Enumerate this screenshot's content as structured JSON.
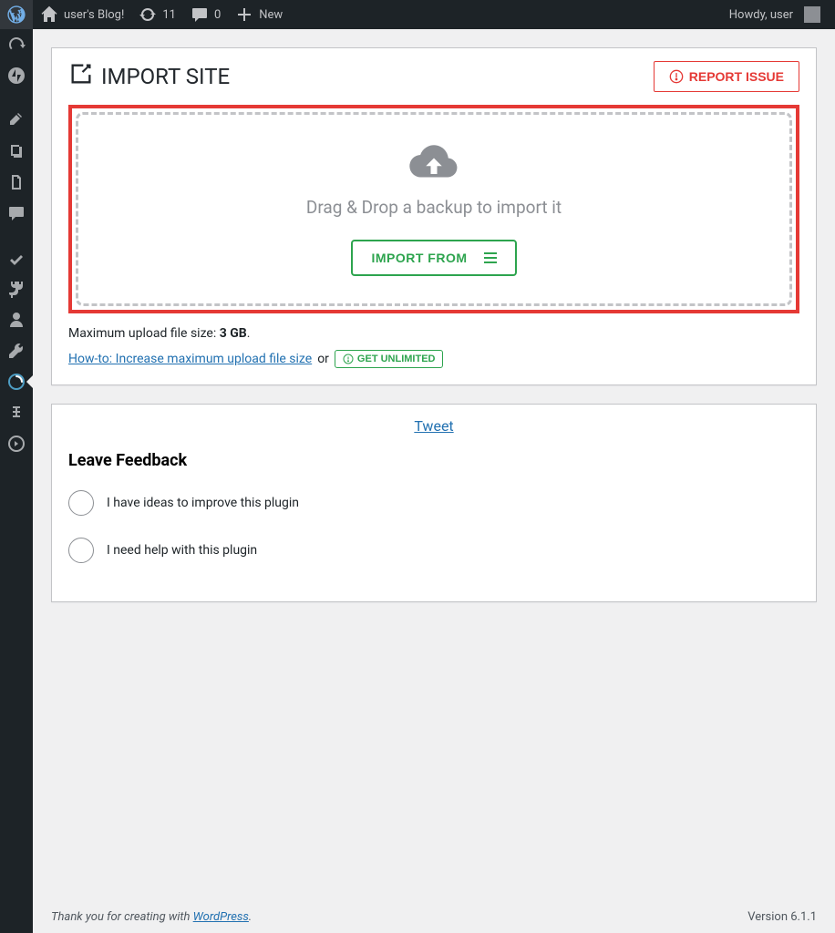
{
  "adminbar": {
    "site_name": "user's Blog!",
    "updates": "11",
    "comments": "0",
    "new_label": "New",
    "greeting": "Howdy, user"
  },
  "page": {
    "title": "IMPORT SITE",
    "report_issue": "REPORT ISSUE",
    "drop_text": "Drag & Drop a backup to import it",
    "import_from": "IMPORT FROM",
    "max_upload_prefix": "Maximum upload file size: ",
    "max_upload_value": "3 GB",
    "max_upload_suffix": ".",
    "howto_link": "How-to: Increase maximum upload file size",
    "or": " or ",
    "get_unlimited": "GET UNLIMITED",
    "tweet": "Tweet",
    "feedback_title": "Leave Feedback",
    "feedback_opts": [
      "I have ideas to improve this plugin",
      "I need help with this plugin"
    ]
  },
  "footer": {
    "thanks_prefix": "Thank you for creating with ",
    "wp": "WordPress",
    "thanks_suffix": ".",
    "version": "Version 6.1.1"
  }
}
